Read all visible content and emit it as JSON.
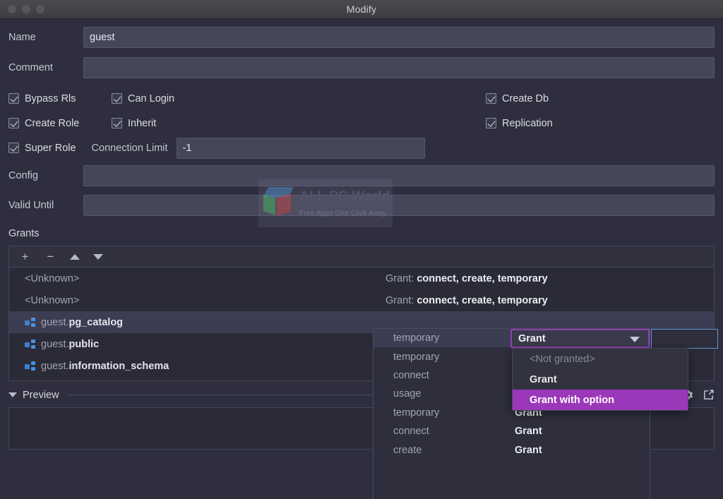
{
  "window": {
    "title": "Modify",
    "traffic_lights": [
      "close-button",
      "minimize-button",
      "zoom-button"
    ]
  },
  "form": {
    "name_label": "Name",
    "name_value": "guest",
    "comment_label": "Comment",
    "comment_value": "",
    "config_label": "Config",
    "config_value": "",
    "valid_until_label": "Valid Until",
    "valid_until_value": "",
    "connection_limit_label": "Connection Limit",
    "connection_limit_value": "-1",
    "checkboxes": [
      {
        "label": "Bypass Rls",
        "checked": true
      },
      {
        "label": "Can Login",
        "checked": true
      },
      {
        "label": "Create Db",
        "checked": true
      },
      {
        "label": "Create Role",
        "checked": true
      },
      {
        "label": "Inherit",
        "checked": true
      },
      {
        "label": "Replication",
        "checked": true
      },
      {
        "label": "Super Role",
        "checked": true
      }
    ]
  },
  "grants": {
    "section_label": "Grants",
    "toolbar": {
      "add": "+",
      "remove": "−",
      "move_up": "move-up",
      "move_down": "move-down"
    },
    "rows": [
      {
        "name": "<Unknown>",
        "icon": null,
        "value_prefix": "Grant:",
        "value": "connect, create, temporary",
        "selected": false
      },
      {
        "name": "<Unknown>",
        "icon": null,
        "value_prefix": "Grant:",
        "value": "connect, create, temporary",
        "selected": false
      },
      {
        "name_prefix": "guest.",
        "name_bold": "pg_catalog",
        "icon": "schema-icon",
        "selected": true
      },
      {
        "name_prefix": "guest.",
        "name_bold": "public",
        "icon": "schema-icon",
        "selected": false
      },
      {
        "name_prefix": "guest.",
        "name_bold": "information_schema",
        "icon": "schema-icon",
        "selected": false
      }
    ]
  },
  "permission_popup": {
    "rows": [
      {
        "privilege": "temporary",
        "grant": "",
        "highlighted": true
      },
      {
        "privilege": "temporary",
        "grant": ""
      },
      {
        "privilege": "connect",
        "grant": ""
      },
      {
        "privilege": "usage",
        "grant": ""
      },
      {
        "privilege": "temporary",
        "grant": "Grant"
      },
      {
        "privilege": "connect",
        "grant": "Grant"
      },
      {
        "privilege": "create",
        "grant": "Grant"
      }
    ]
  },
  "combo": {
    "selected_value": "Grant",
    "options": [
      {
        "label": "<Not granted>",
        "disabled": true,
        "selected": false
      },
      {
        "label": "Grant",
        "disabled": false,
        "selected": false
      },
      {
        "label": "Grant with option",
        "disabled": false,
        "selected": true
      }
    ]
  },
  "preview": {
    "label": "Preview",
    "settings_icon": "gear-icon",
    "popout_icon": "open-in-new-window-icon",
    "content": ""
  },
  "watermark": {
    "title": "ALL PC World",
    "subtitle": "Free Apps One Click Away"
  },
  "colors": {
    "window_bg": "#2e2e3e",
    "field_bg": "#464659",
    "accent_purple": "#9b38b9",
    "combo_border": "#8e3fb0",
    "focus_blue": "#5b9bd5",
    "schema_icon_blue": "#4a90e2"
  }
}
